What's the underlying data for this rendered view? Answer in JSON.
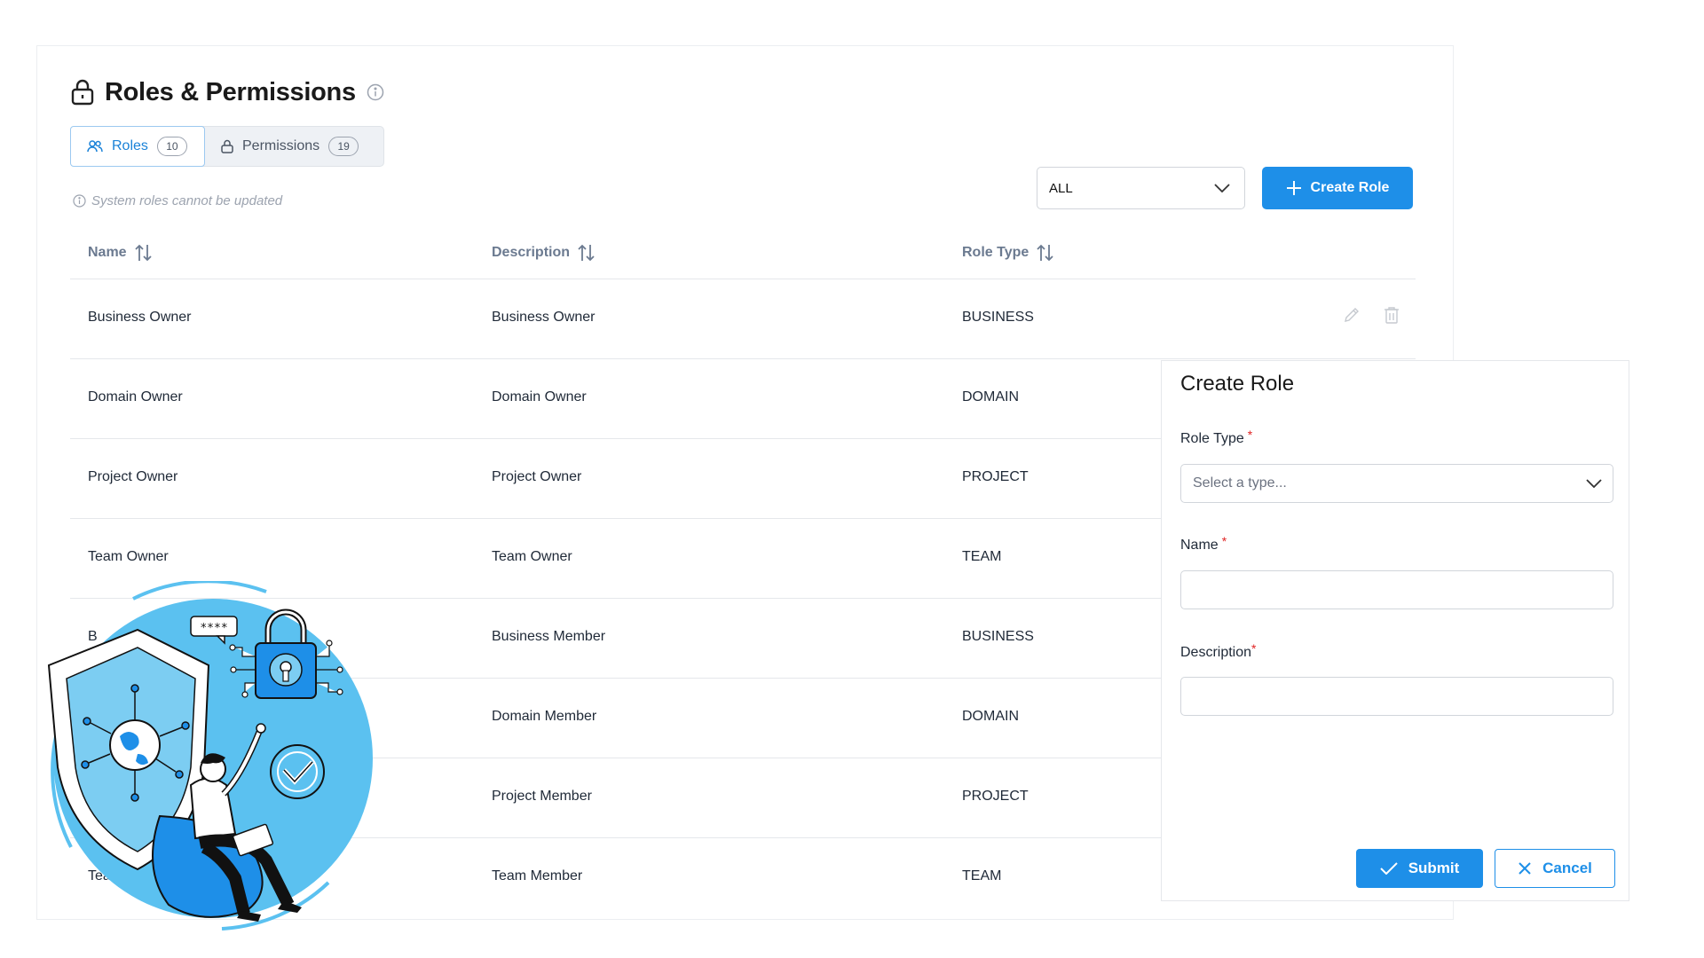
{
  "header": {
    "title": "Roles & Permissions"
  },
  "tabs": [
    {
      "label": "Roles",
      "count": "10",
      "active": true
    },
    {
      "label": "Permissions",
      "count": "19",
      "active": false
    }
  ],
  "hint": "System roles cannot be updated",
  "toolbar": {
    "filter_value": "ALL",
    "create_label": "Create Role"
  },
  "table": {
    "columns": [
      "Name",
      "Description",
      "Role Type"
    ],
    "rows": [
      {
        "name": "Business Owner",
        "description": "Business Owner",
        "type": "BUSINESS"
      },
      {
        "name": "Domain Owner",
        "description": "Domain Owner",
        "type": "DOMAIN"
      },
      {
        "name": "Project Owner",
        "description": "Project Owner",
        "type": "PROJECT"
      },
      {
        "name": "Team Owner",
        "description": "Team Owner",
        "type": "TEAM"
      },
      {
        "name": "B",
        "description": "Business Member",
        "type": "BUSINESS"
      },
      {
        "name": "",
        "description": "Domain Member",
        "type": "DOMAIN"
      },
      {
        "name": "",
        "description": "Project Member",
        "type": "PROJECT"
      },
      {
        "name": "Tea",
        "description": "Team Member",
        "type": "TEAM"
      }
    ]
  },
  "panel": {
    "title": "Create Role",
    "role_type_label": "Role Type",
    "role_type_placeholder": "Select a type...",
    "name_label": "Name",
    "description_label": "Description",
    "required_mark": "*",
    "submit_label": "Submit",
    "cancel_label": "Cancel"
  },
  "illustration": {
    "password_bubble": "****"
  },
  "colors": {
    "accent": "#1e8fe8",
    "illustration_blue": "#5bc1f0",
    "required": "#e02424"
  }
}
